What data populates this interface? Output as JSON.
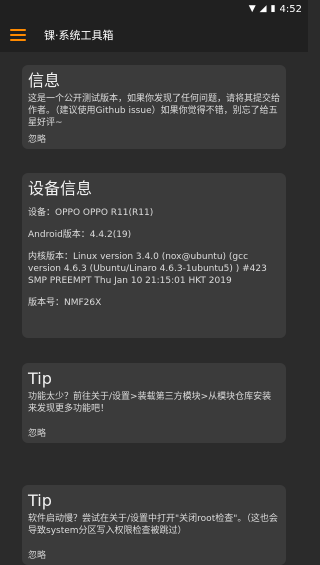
{
  "status": {
    "time": "4:52"
  },
  "app": {
    "title": "锞·系统工具箱"
  },
  "cards": [
    {
      "title": "信息",
      "body": "这是一个公开测试版本，如果你发现了任何问题，请将其提交给作者。（建议使用Github issue）如果你觉得不错，别忘了给五星好评~",
      "action": "忽略"
    },
    {
      "title": "设备信息",
      "lines": [
        "设备：OPPO  OPPO R11(R11)",
        "Android版本：4.4.2(19)",
        "内核版本：Linux version 3.4.0 (nox@ubuntu) (gcc version 4.6.3 (Ubuntu/Linaro 4.6.3-1ubuntu5) ) #423 SMP PREEMPT Thu Jan 10 21:15:01 HKT 2019",
        "版本号：NMF26X"
      ]
    },
    {
      "title": "Tip",
      "body": "功能太少？前往关于/设置>装载第三方模块>从模块仓库安装 来发现更多功能吧！",
      "action": "忽略"
    },
    {
      "title": "Tip",
      "body": "软件启动慢？尝试在关于/设置中打开\"关闭root检查\"。（这也会导致system分区写入权限检查被跳过）",
      "action": "忽略"
    }
  ]
}
